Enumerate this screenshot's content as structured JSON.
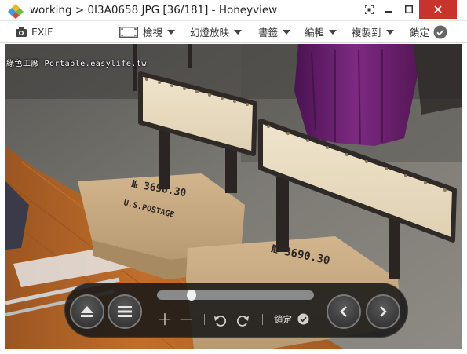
{
  "window": {
    "title": "working > 0I3A0658.JPG [36/181] - Honeyview"
  },
  "toolbar": {
    "exif_label": "EXIF",
    "view_label": "檢視",
    "slideshow_label": "幻燈放映",
    "bookmark_label": "書籤",
    "edit_label": "編輯",
    "copy_to_label": "複製到",
    "lock_label": "鎖定"
  },
  "image": {
    "watermark": "綠色工廠 Portable.easylife.tw",
    "stamp_text_front": "№ 3690.30",
    "stamp_text_back": "№ 3690.30",
    "stamp_sub": "U.S.POSTAGE"
  },
  "controls": {
    "slider_position": 0.2,
    "lock_label": "鎖定"
  },
  "colors": {
    "close_button": "#c7342c",
    "panel_bg": "#181818",
    "table_wood": "#b8672a",
    "jacket": "#6b1f6e",
    "burlap": "#c7aa80"
  }
}
